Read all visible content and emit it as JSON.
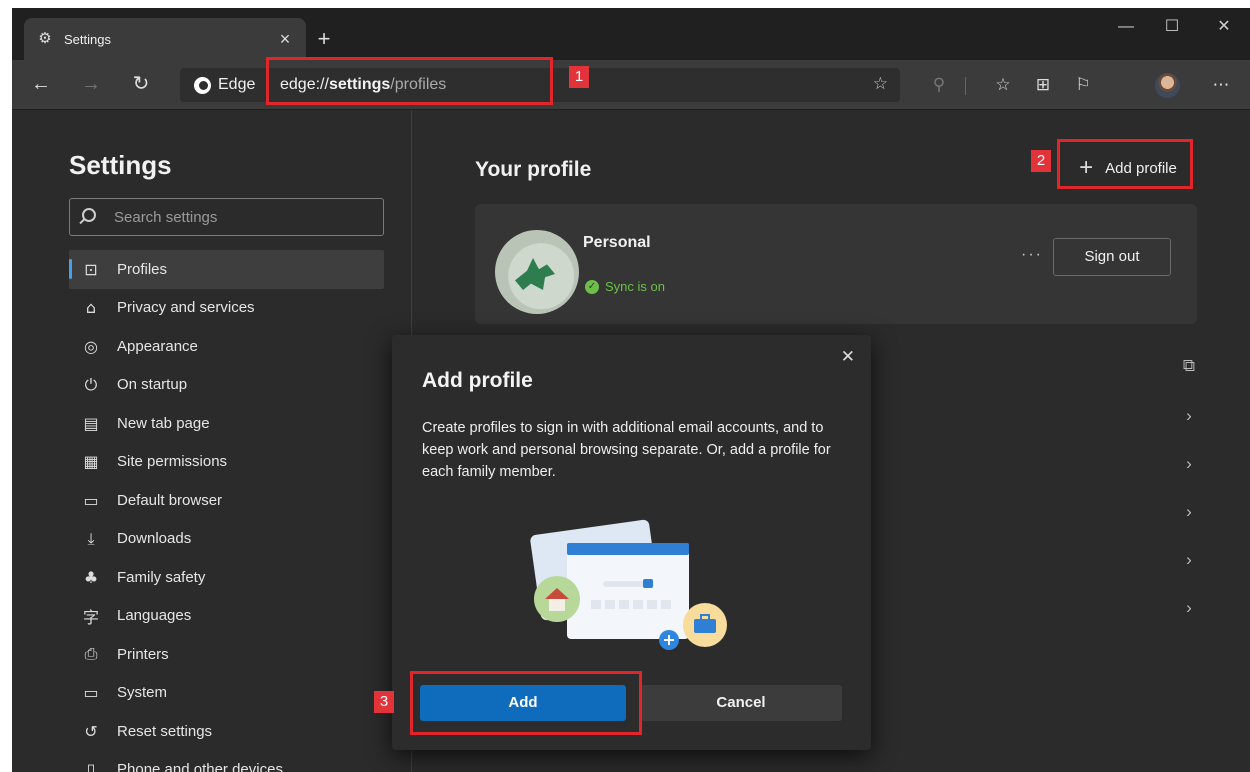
{
  "tab": {
    "title": "Settings",
    "icon": "gear-icon"
  },
  "toolbar": {
    "edge_label": "Edge",
    "url_scheme": "edge://",
    "url_host": "settings",
    "url_path": "/profiles"
  },
  "sidebar": {
    "title": "Settings",
    "search_placeholder": "Search settings",
    "items": [
      {
        "label": "Profiles",
        "icon": "profile-icon",
        "glyph": "⊡",
        "active": true
      },
      {
        "label": "Privacy and services",
        "icon": "lock-icon",
        "glyph": "⌂"
      },
      {
        "label": "Appearance",
        "icon": "palette-icon",
        "glyph": "◎"
      },
      {
        "label": "On startup",
        "icon": "power-icon",
        "glyph": "⏻"
      },
      {
        "label": "New tab page",
        "icon": "newtab-icon",
        "glyph": "▤"
      },
      {
        "label": "Site permissions",
        "icon": "permissions-icon",
        "glyph": "▦"
      },
      {
        "label": "Default browser",
        "icon": "browser-icon",
        "glyph": "▭"
      },
      {
        "label": "Downloads",
        "icon": "download-icon",
        "glyph": "⤓"
      },
      {
        "label": "Family safety",
        "icon": "family-icon",
        "glyph": "♣"
      },
      {
        "label": "Languages",
        "icon": "language-icon",
        "glyph": "字"
      },
      {
        "label": "Printers",
        "icon": "printer-icon",
        "glyph": "⎙"
      },
      {
        "label": "System",
        "icon": "system-icon",
        "glyph": "▭"
      },
      {
        "label": "Reset settings",
        "icon": "reset-icon",
        "glyph": "↺"
      },
      {
        "label": "Phone and other devices",
        "icon": "phone-icon",
        "glyph": "▯"
      }
    ]
  },
  "main": {
    "title": "Your profile",
    "add_profile_label": "Add profile",
    "profile_name": "Personal",
    "sync_status": "Sync is on",
    "sign_out_label": "Sign out"
  },
  "modal": {
    "title": "Add profile",
    "body": "Create profiles to sign in with additional email accounts, and to keep work and personal browsing separate. Or, add a profile for each family member.",
    "add_label": "Add",
    "cancel_label": "Cancel"
  },
  "callouts": [
    "1",
    "2",
    "3"
  ],
  "colors": {
    "accent": "#0f6cbd",
    "highlight": "#e0262a",
    "sync_green": "#6cc04a"
  }
}
